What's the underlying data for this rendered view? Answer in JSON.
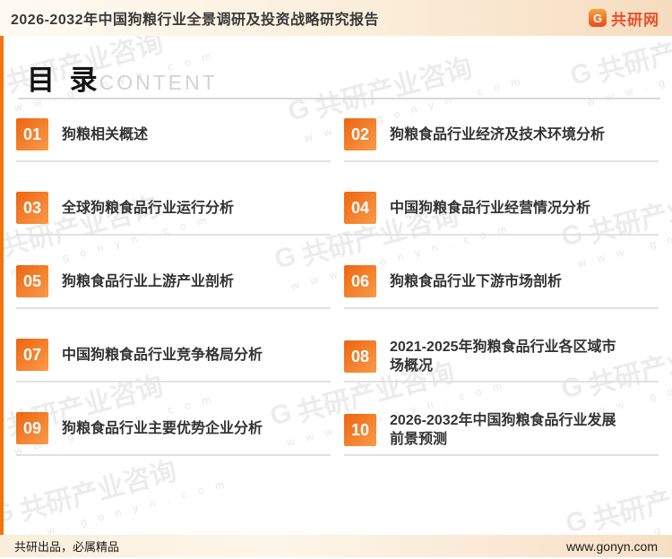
{
  "header": {
    "title": "2026-2032年中国狗粮行业全景调研及投资战略研究报告",
    "logo": {
      "g": "G",
      "brand": "共研网"
    }
  },
  "toc": {
    "title": "目 录",
    "subtitle": "CONTENT",
    "items": [
      {
        "num": "01",
        "label": "狗粮相关概述"
      },
      {
        "num": "02",
        "label": "狗粮食品行业经济及技术环境分析"
      },
      {
        "num": "03",
        "label": "全球狗粮食品行业运行分析"
      },
      {
        "num": "04",
        "label": "中国狗粮食品行业经营情况分析"
      },
      {
        "num": "05",
        "label": "狗粮食品行业上游产业剖析"
      },
      {
        "num": "06",
        "label": "狗粮食品行业下游市场剖析"
      },
      {
        "num": "07",
        "label": "中国狗粮食品行业竞争格局分析"
      },
      {
        "num": "08",
        "label": "2021-2025年狗粮食品行业各区域市场概况"
      },
      {
        "num": "09",
        "label": "狗粮食品行业主要优势企业分析"
      },
      {
        "num": "10",
        "label": "2026-2032年中国狗粮食品行业发展前景预测"
      }
    ]
  },
  "watermark": {
    "g": "G",
    "brand": "共研产业咨询",
    "url": "w w w . g o n y n . c o m"
  },
  "footer": {
    "left": "共研出品，必属精品",
    "right": "www.gonyn.com"
  },
  "colors": {
    "accent": "#f1740f",
    "num_gradient_start": "#ee650f",
    "num_gradient_end": "#f99b4a",
    "brand_red": "#ea4f26"
  }
}
